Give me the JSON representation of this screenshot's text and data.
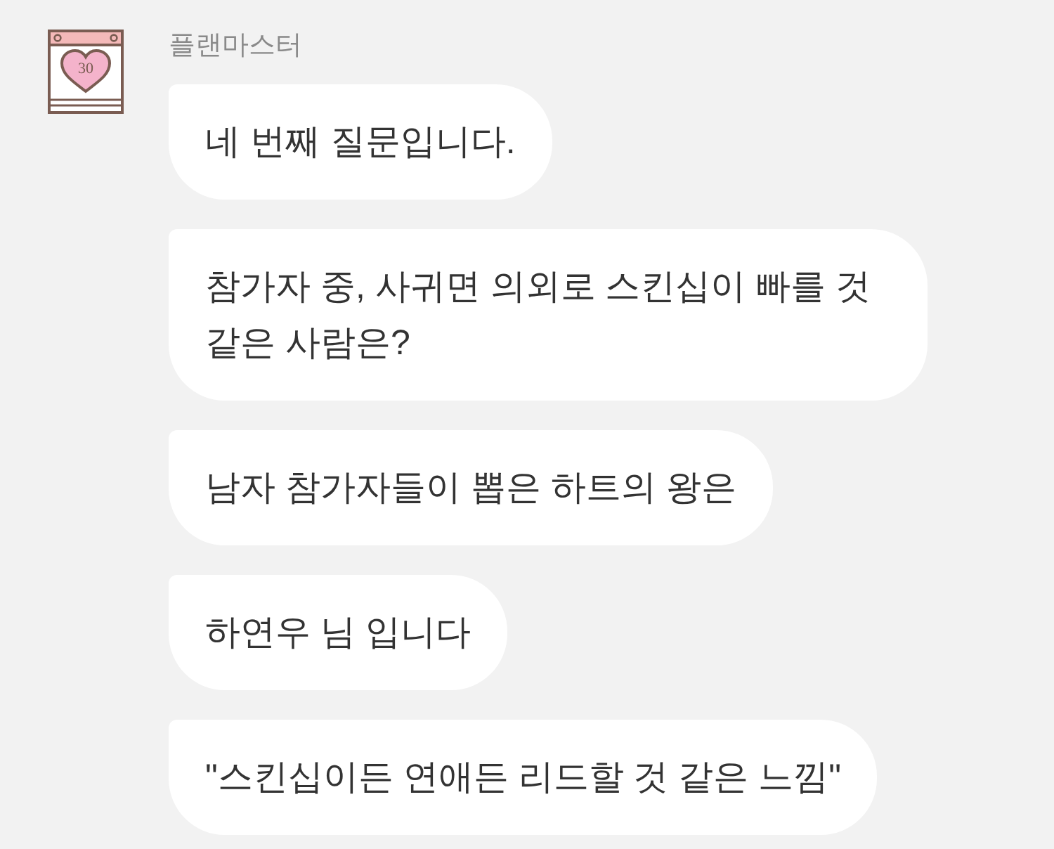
{
  "sender": {
    "name": "플랜마스터",
    "avatar_day": "30"
  },
  "messages": [
    {
      "text": "네 번째 질문입니다."
    },
    {
      "text": "참가자 중, 사귀면 의외로 스킨십이 빠를 것 같은 사람은?"
    },
    {
      "text": "남자 참가자들이 뽑은 하트의 왕은"
    },
    {
      "text": "하연우 님 입니다"
    },
    {
      "text": "\"스킨십이든 연애든 리드할 것 같은 느낌\""
    }
  ]
}
